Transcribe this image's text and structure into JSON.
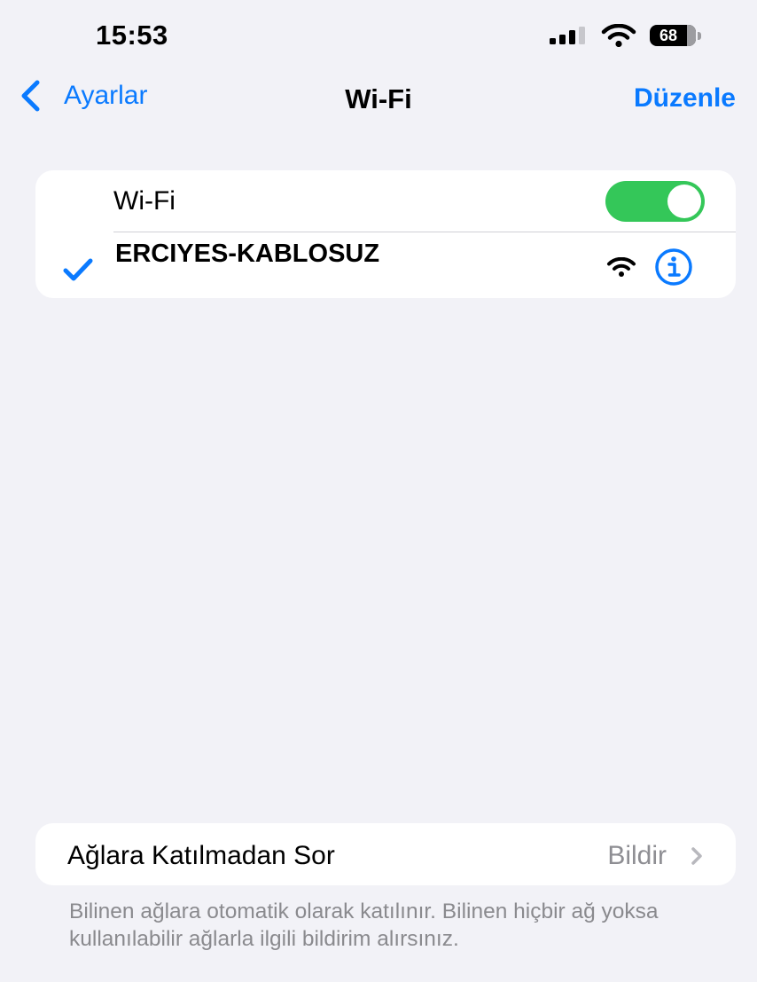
{
  "status_bar": {
    "time": "15:53",
    "battery": "68",
    "battery_level_percent": 68
  },
  "nav": {
    "back_label": "Ayarlar",
    "title": "Wi-Fi",
    "edit_label": "Düzenle"
  },
  "wifi": {
    "label": "Wi-Fi",
    "enabled": true,
    "connected_network": "ERCIYES-KABLOSUZ"
  },
  "ask_to_join": {
    "label": "Ağlara Katılmadan Sor",
    "value": "Bildir",
    "footer": "Bilinen ağlara otomatik olarak katılınır. Bilinen hiçbir ağ yoksa kullanılabilir ağlarla ilgili bildirim alırsınız."
  },
  "colors": {
    "accent": "#0a7aff",
    "toggle_on": "#34c759",
    "background": "#f2f2f7",
    "secondary_text": "#8e8e93"
  },
  "icons": {
    "back": "chevron-left-icon",
    "signal": "cellular-signal-icon",
    "wifi_status": "wifi-icon",
    "battery": "battery-icon",
    "checkmark": "checkmark-icon",
    "network_signal": "wifi-icon",
    "info": "info-icon",
    "disclosure": "chevron-right-icon"
  }
}
